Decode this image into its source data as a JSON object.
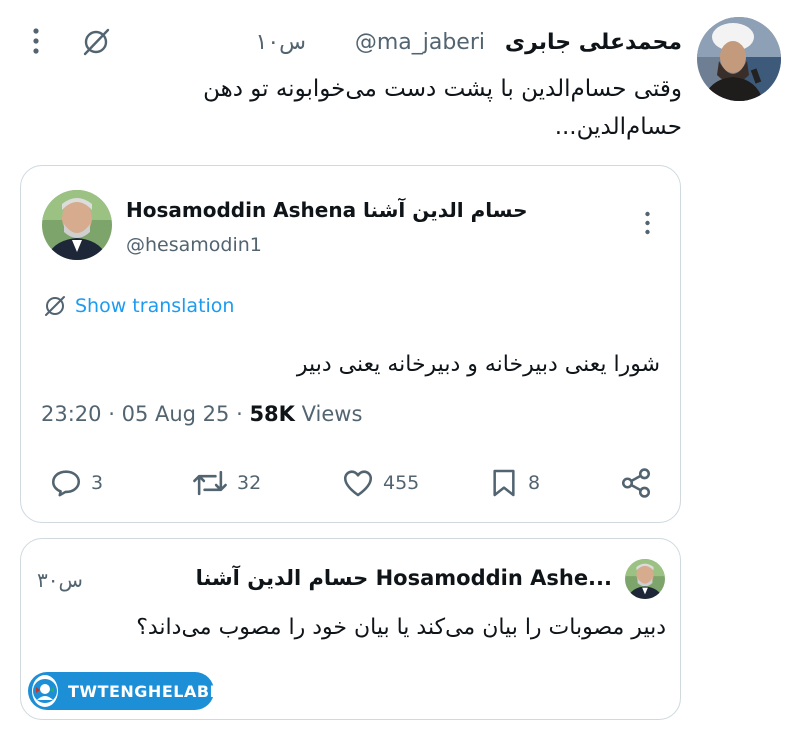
{
  "main_tweet": {
    "author_name": "محمدعلی جابری",
    "handle": "@ma_jaberi",
    "time": "۱۰س",
    "text": "وقتی حسام‌الدین با پشت دست می‌خوابونه تو دهن حسام‌الدین..."
  },
  "quoted_tweet": {
    "author_name": "Hosamoddin Ashena حسام الدین آشنا",
    "handle": "@hesamodin1",
    "show_translation": "Show translation",
    "text": "شورا یعنی دبیرخانه و دبیرخانه یعنی دبیر",
    "time": "23:20",
    "date": "05 Aug 25",
    "views_count": "58K",
    "views_label": "Views",
    "replies": "3",
    "retweets": "32",
    "likes": "455",
    "bookmarks": "8"
  },
  "reply_tweet": {
    "author_name": "حسام الدین آشنا Hosamoddin Ashe...",
    "time": "۳۰س",
    "text": "دبیر مصوبات را بیان می‌کند یا بیان خود را مصوب می‌داند؟"
  },
  "watermark": {
    "label": "TWTENGHELABI"
  },
  "colors": {
    "text": "#0f1419",
    "secondary": "#536471",
    "border": "#cfd9de",
    "badge": "#1d8fd6"
  }
}
